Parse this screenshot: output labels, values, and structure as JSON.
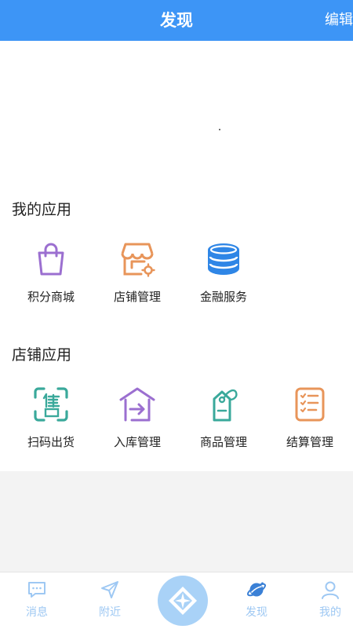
{
  "header": {
    "title": "发现",
    "edit_label": "编辑"
  },
  "my_apps": {
    "title": "我的应用",
    "items": [
      {
        "label": "积分商城",
        "icon": "shopping-bag-icon",
        "color": "#9b6fd0"
      },
      {
        "label": "店铺管理",
        "icon": "storefront-icon",
        "color": "#e8955a"
      },
      {
        "label": "金融服务",
        "icon": "coin-stack-icon",
        "color": "#2f86e6"
      }
    ]
  },
  "store_apps": {
    "title": "店铺应用",
    "items": [
      {
        "label": "扫码出货",
        "icon": "scan-icon",
        "color": "#3aa99b"
      },
      {
        "label": "入库管理",
        "icon": "warehouse-in-icon",
        "color": "#9b6fd0"
      },
      {
        "label": "商品管理",
        "icon": "price-tag-icon",
        "color": "#3aa99b"
      },
      {
        "label": "结算管理",
        "icon": "checklist-icon",
        "color": "#e8955a"
      }
    ]
  },
  "bottom_nav": {
    "items": [
      {
        "label": "消息",
        "icon": "message-icon",
        "active": false
      },
      {
        "label": "附近",
        "icon": "navigation-arrow-icon",
        "active": false
      },
      {
        "label": "",
        "icon": "diamond-compass-icon",
        "active": false
      },
      {
        "label": "发现",
        "icon": "planet-icon",
        "active": true
      },
      {
        "label": "我的",
        "icon": "user-icon",
        "active": false
      }
    ],
    "inactive_color": "#9ec8f3",
    "active_color": "#3a80d6"
  },
  "colors": {
    "header_bg": "#3d95f6",
    "page_bg": "#f3f3f3"
  }
}
